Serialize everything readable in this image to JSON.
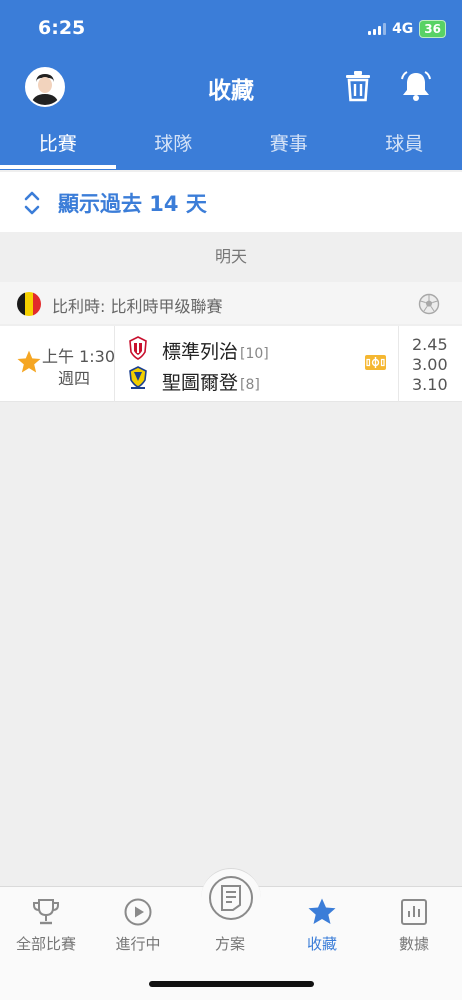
{
  "status_bar": {
    "time": "6:25",
    "network": "4G",
    "battery": "36"
  },
  "header": {
    "title": "收藏"
  },
  "tabs": [
    {
      "label": "比賽"
    },
    {
      "label": "球隊"
    },
    {
      "label": "賽事"
    },
    {
      "label": "球員"
    }
  ],
  "history_toggle": {
    "label": "顯示過去 14 天"
  },
  "day_header": "明天",
  "league": {
    "name": "比利時: 比利時甲级聯賽",
    "flag_colors": [
      "#1a1a1a",
      "#f6d100",
      "#e22b2b"
    ]
  },
  "match": {
    "time": "上午 1:30",
    "weekday": "週四",
    "home": {
      "name": "標準列治",
      "rank": "[10]"
    },
    "away": {
      "name": "聖圖爾登",
      "rank": "[8]"
    },
    "odds": [
      "2.45",
      "3.00",
      "3.10"
    ]
  },
  "bottom_nav": [
    {
      "label": "全部比賽",
      "icon": "trophy-icon"
    },
    {
      "label": "進行中",
      "icon": "play-icon"
    },
    {
      "label": "方案",
      "icon": "document-icon"
    },
    {
      "label": "收藏",
      "icon": "star-icon"
    },
    {
      "label": "數據",
      "icon": "bar-chart-icon"
    }
  ],
  "colors": {
    "primary": "#3b7dd8",
    "star": "#f5a623",
    "live_badge": "#f5b731",
    "battery": "#58d265"
  }
}
